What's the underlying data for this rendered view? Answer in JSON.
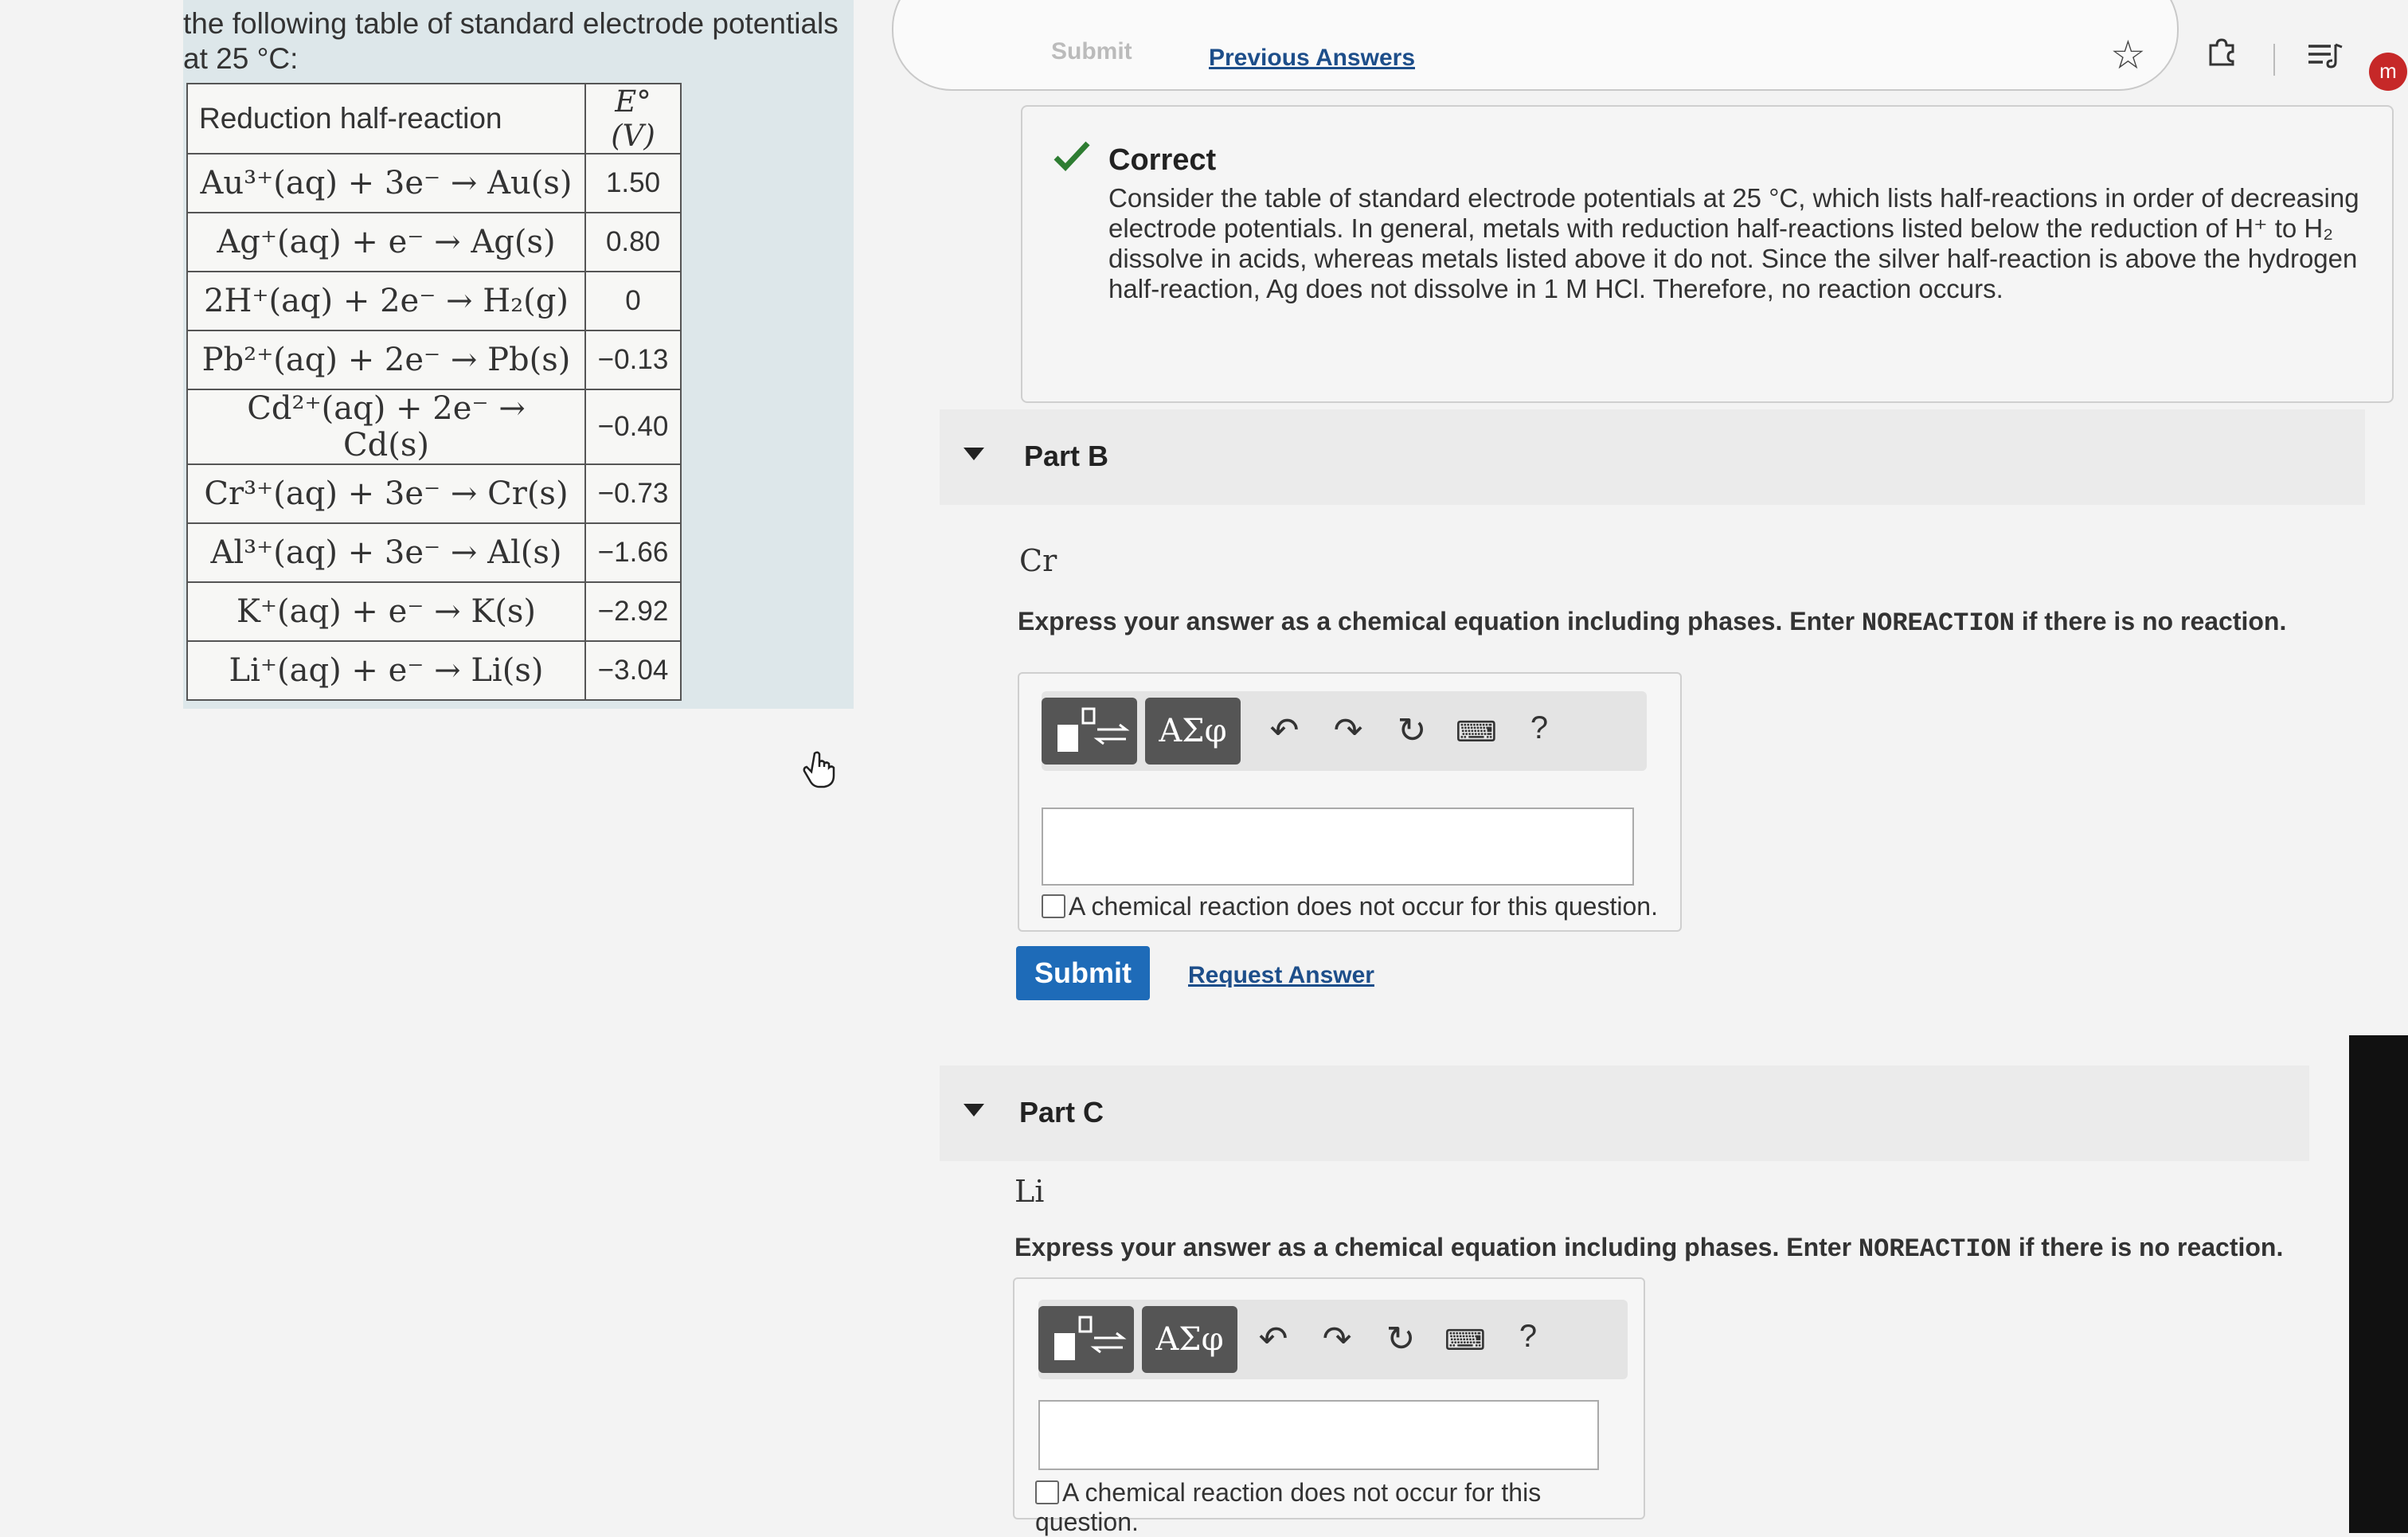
{
  "left": {
    "intro": [
      "the following table of standard electrode potentials",
      "at 25 °C:"
    ],
    "table": {
      "headers": [
        "Reduction half-reaction",
        "E° (V)"
      ],
      "rows": [
        {
          "reaction": "Au³⁺(aq) + 3e⁻ → Au(s)",
          "potential": "1.50"
        },
        {
          "reaction": "Ag⁺(aq) + e⁻ → Ag(s)",
          "potential": "0.80"
        },
        {
          "reaction": "2H⁺(aq) + 2e⁻ → H₂(g)",
          "potential": "0"
        },
        {
          "reaction": "Pb²⁺(aq) + 2e⁻ → Pb(s)",
          "potential": "−0.13"
        },
        {
          "reaction": "Cd²⁺(aq) + 2e⁻ → Cd(s)",
          "potential": "−0.40"
        },
        {
          "reaction": "Cr³⁺(aq) + 3e⁻ → Cr(s)",
          "potential": "−0.73"
        },
        {
          "reaction": "Al³⁺(aq) + 3e⁻ → Al(s)",
          "potential": "−1.66"
        },
        {
          "reaction": "K⁺(aq) + e⁻ → K(s)",
          "potential": "−2.92"
        },
        {
          "reaction": "Li⁺(aq) + e⁻ → Li(s)",
          "potential": "−3.04"
        }
      ]
    }
  },
  "top": {
    "submit_label": "Submit",
    "previous_answers_label": "Previous Answers",
    "avatar_initial": "m"
  },
  "feedback": {
    "title": "Correct",
    "text": "Consider the table of standard electrode potentials at 25 °C, which lists half-reactions in order of decreasing electrode potentials. In general, metals with reduction half-reactions listed below the reduction of H⁺ to H₂ dissolve in acids, whereas metals listed above it do not. Since the silver half-reaction is above the hydrogen half-reaction, Ag does not dissolve in 1 M HCl. Therefore, no reaction occurs."
  },
  "partB": {
    "title": "Part B",
    "element": "Cr",
    "instruction_pre": "Express your answer as a chemical equation including phases. Enter ",
    "instruction_code": "NOREACTION",
    "instruction_post": " if there is no reaction.",
    "greek_label": "ΑΣφ",
    "help_label": "?",
    "checkbox_label": "A chemical reaction does not occur for this question.",
    "submit_label": "Submit",
    "request_label": "Request Answer"
  },
  "partC": {
    "title": "Part C",
    "element": "Li",
    "instruction_pre": "Express your answer as a chemical equation including phases. Enter ",
    "instruction_code": "NOREACTION",
    "instruction_post": " if there is no reaction.",
    "greek_label": "ΑΣφ",
    "help_label": "?",
    "checkbox_label": "A chemical reaction does not occur for this question."
  },
  "colors": {
    "accent": "#1e6bb8",
    "check": "#2e7d32",
    "avatar": "#c62828",
    "panel": "#dde7ea"
  }
}
